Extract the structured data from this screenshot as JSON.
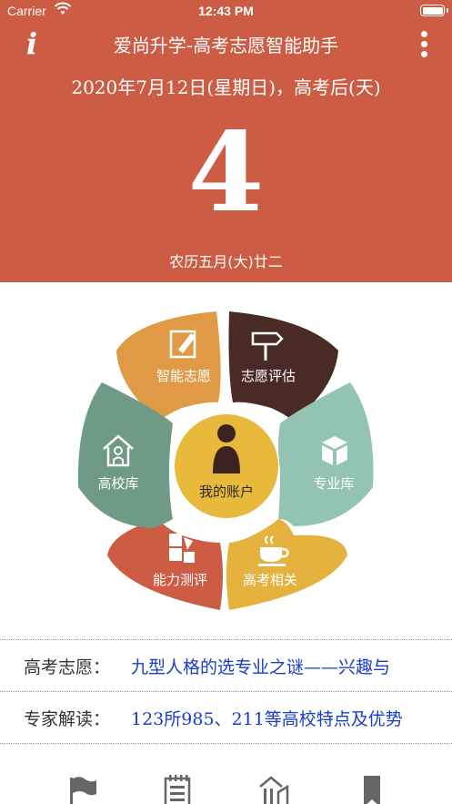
{
  "status_bar": {
    "carrier": "Carrier",
    "time": "12:43 PM"
  },
  "header": {
    "app_title": "爱尚升学-高考志愿智能助手",
    "date_line": "2020年7月12日(星期日)，高考后(天)",
    "day_count": "4",
    "lunar_date": "农历五月(大)廿二",
    "info_icon": "i",
    "background_color": "#cd5c45"
  },
  "wheel": {
    "center": {
      "label": "我的账户",
      "icon": "person-icon",
      "color": "#e8b93a"
    },
    "segments": [
      {
        "label": "智能志愿",
        "icon": "edit-icon",
        "color": "#e09a45"
      },
      {
        "label": "志愿评估",
        "icon": "signpost-icon",
        "color": "#4a2a24"
      },
      {
        "label": "专业库",
        "icon": "box-icon",
        "color": "#93c4b2"
      },
      {
        "label": "高考相关",
        "icon": "coffee-icon",
        "color": "#e5b23e"
      },
      {
        "label": "能力测评",
        "icon": "puzzle-icon",
        "color": "#cd5c45"
      },
      {
        "label": "高校库",
        "icon": "house-icon",
        "color": "#6f9a87"
      }
    ]
  },
  "news": [
    {
      "tag": "高考志愿：",
      "title": "九型人格的选专业之谜——兴趣与"
    },
    {
      "tag": "专家解读：",
      "title": "123所985、211等高校特点及优势"
    }
  ],
  "tabbar": {
    "icons": [
      "flag-icon",
      "notepad-icon",
      "school-icon",
      "bookmark-icon"
    ]
  }
}
